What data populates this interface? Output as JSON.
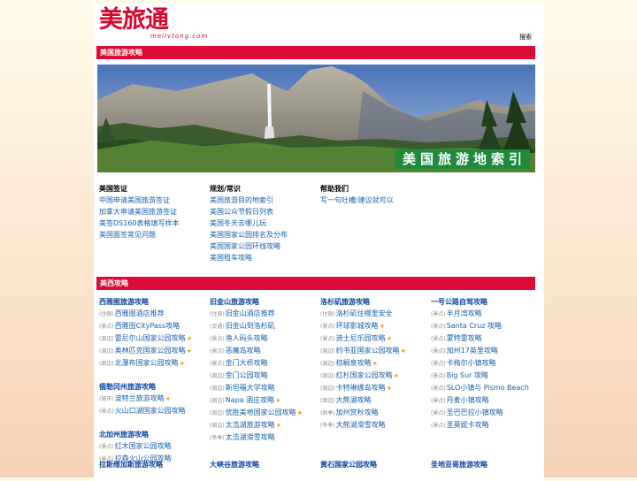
{
  "logo": {
    "text": "美旅通",
    "subtext": "meilvtong.com"
  },
  "header": {
    "search": "搜索"
  },
  "section1": {
    "title": "美国旅游攻略"
  },
  "banner": {
    "caption": "美国旅游地索引"
  },
  "guides": [
    {
      "heading": "美国签证",
      "links": [
        "中国申请美国旅游签证",
        "加拿大申请美国旅游签证",
        "美签DS160表格填写样本",
        "美国面签常见问题"
      ]
    },
    {
      "heading": "规划/常识",
      "links": [
        "美国旅游目的地索引",
        "美国公众节假日列表",
        "美国冬天去哪儿玩",
        "美国国家公园排名及分布",
        "美国国家公园环线攻略",
        "美国租车攻略"
      ]
    },
    {
      "heading": "帮助我们",
      "links": [
        "写一句吐槽/建议就可以"
      ]
    }
  ],
  "section2": {
    "title": "美西攻略"
  },
  "west_cols": [
    {
      "groups": [
        {
          "title": "西雅图旅游攻略",
          "items": [
            {
              "tag": "(住宿)",
              "text": "西雅图酒店推荐",
              "star": ""
            },
            {
              "tag": "(景点)",
              "text": "西雅图CityPass攻略",
              "star": ""
            },
            {
              "tag": "(周边)",
              "text": "雷尼尔山国家公园攻略",
              "star": "★"
            },
            {
              "tag": "(周边)",
              "text": "奥林匹克国家公园攻略",
              "star": "★"
            },
            {
              "tag": "(周边)",
              "text": "北瀑布国家公园攻略",
              "star": "★"
            }
          ]
        },
        {
          "title": "俄勒冈州旅游攻略",
          "items": [
            {
              "tag": "(城市)",
              "text": "波特兰旅游攻略",
              "star": "★"
            },
            {
              "tag": "(景点)",
              "text": "火山口湖国家公园攻略",
              "star": ""
            }
          ]
        },
        {
          "title": "北加州旅游攻略",
          "items": [
            {
              "tag": "(景点)",
              "text": "红木国家公园攻略",
              "star": ""
            },
            {
              "tag": "(景点)",
              "text": "拉森火山公园攻略",
              "star": ""
            }
          ]
        }
      ]
    },
    {
      "groups": [
        {
          "title": "旧金山旅游攻略",
          "items": [
            {
              "tag": "(住宿)",
              "text": "旧金山酒店推荐",
              "star": ""
            },
            {
              "tag": "(交通)",
              "text": "旧金山到洛杉矶",
              "star": ""
            },
            {
              "tag": "(景点)",
              "text": "渔人码头攻略",
              "star": ""
            },
            {
              "tag": "(景点)",
              "text": "恶魔岛攻略",
              "star": ""
            },
            {
              "tag": "(景点)",
              "text": "金门大桥攻略",
              "star": ""
            },
            {
              "tag": "(周边)",
              "text": "金门公园攻略",
              "star": ""
            },
            {
              "tag": "(周边)",
              "text": "斯坦福大学攻略",
              "star": ""
            },
            {
              "tag": "(周边)",
              "text": "Napa 酒庄攻略",
              "star": "★"
            },
            {
              "tag": "(周边)",
              "text": "优胜美地国家公园攻略",
              "star": "★"
            },
            {
              "tag": "(周边)",
              "text": "太浩湖旅游攻略",
              "star": "★"
            },
            {
              "tag": "(冬季)",
              "text": "太浩湖滑雪攻略",
              "star": ""
            }
          ]
        }
      ]
    },
    {
      "groups": [
        {
          "title": "洛杉矶旅游攻略",
          "items": [
            {
              "tag": "(住宿)",
              "text": "洛杉矶住哪里安全",
              "star": ""
            },
            {
              "tag": "(景点)",
              "text": "环球影城攻略",
              "star": "★"
            },
            {
              "tag": "(景点)",
              "text": "迪士尼乐园攻略",
              "star": "★"
            },
            {
              "tag": "(周边)",
              "text": "约书亚国家公园攻略",
              "star": "★"
            },
            {
              "tag": "(周边)",
              "text": "棕榈泉攻略",
              "star": "★"
            },
            {
              "tag": "(周边)",
              "text": "红杉国家公园攻略",
              "star": "★"
            },
            {
              "tag": "(周边)",
              "text": "卡特琳娜岛攻略",
              "star": "★"
            },
            {
              "tag": "(周边)",
              "text": "大熊湖攻略",
              "star": ""
            },
            {
              "tag": "(秋季)",
              "text": "加州赏秋攻略",
              "star": ""
            },
            {
              "tag": "(冬季)",
              "text": "大熊湖滑雪攻略",
              "star": ""
            }
          ]
        }
      ]
    },
    {
      "groups": [
        {
          "title": "一号公路自驾攻略",
          "items": [
            {
              "tag": "(景点)",
              "text": "半月湾攻略",
              "star": ""
            },
            {
              "tag": "(景点)",
              "text": "Santa Cruz 攻略",
              "star": ""
            },
            {
              "tag": "(景点)",
              "text": "蒙特雷攻略",
              "star": ""
            },
            {
              "tag": "(景点)",
              "text": "加州17英里攻略",
              "star": ""
            },
            {
              "tag": "(景点)",
              "text": "卡梅尔小镇攻略",
              "star": ""
            },
            {
              "tag": "(景点)",
              "text": "Big Sur 攻略",
              "star": ""
            },
            {
              "tag": "(景点)",
              "text": "SLO小镇与 Pismo Beach",
              "star": ""
            },
            {
              "tag": "(景点)",
              "text": "丹麦小镇攻略",
              "star": ""
            },
            {
              "tag": "(景点)",
              "text": "圣巴巴拉小镇攻略",
              "star": ""
            },
            {
              "tag": "(景点)",
              "text": "圣莫妮卡攻略",
              "star": ""
            }
          ]
        }
      ]
    }
  ],
  "bottom_titles": [
    "拉斯维加斯旅游攻略",
    "大峡谷旅游攻略",
    "黄石国家公园攻略",
    "圣地亚哥旅游攻略"
  ],
  "colors": {
    "accent": "#dc0b36",
    "link": "#1a5fa8",
    "title": "#0c45a0",
    "star": "#f4a51a",
    "banner_caption_bg": "#1f8a3b"
  }
}
